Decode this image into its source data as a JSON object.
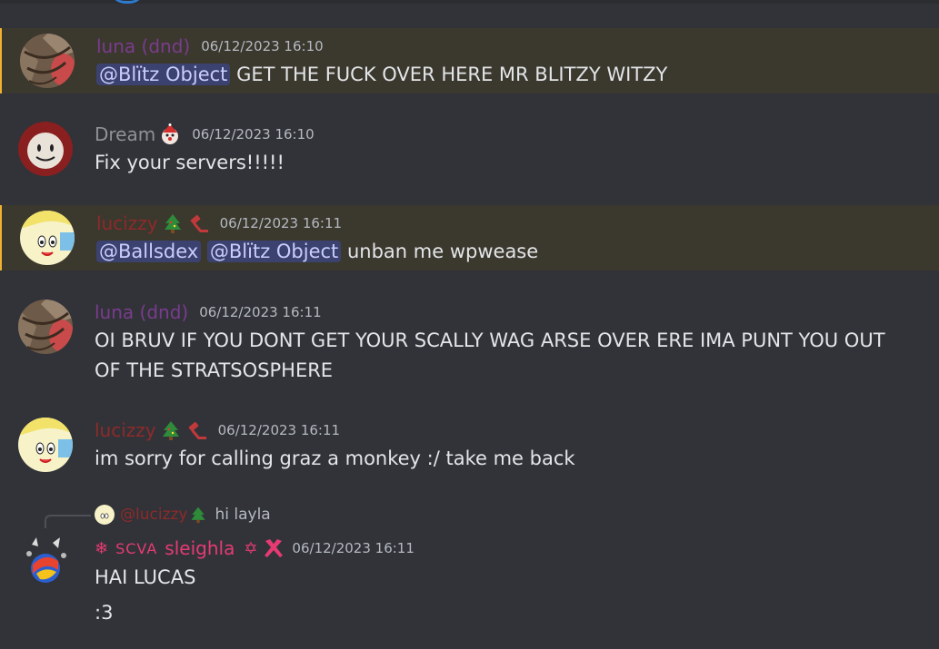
{
  "colors": {
    "background": "#313338",
    "mention_highlight": "#3b382e",
    "mention_pill": "#3c4270",
    "luna": "#7a3c8e",
    "dream": "#8e9297",
    "lucizzy": "#8e2a2a",
    "sleighla": "#e63a73"
  },
  "messages": [
    {
      "username": "luna (dnd)",
      "timestamp": "06/12/2023 16:10",
      "mentions": [
        "@Blïtz Object"
      ],
      "text": "GET THE FUCK OVER HERE MR BLITZY WITZY"
    },
    {
      "username": "Dream",
      "timestamp": "06/12/2023 16:10",
      "text": "Fix your servers!!!!!"
    },
    {
      "username": "lucizzy",
      "timestamp": "06/12/2023 16:11",
      "mentions": [
        "@Ballsdex",
        "@Blïtz Object"
      ],
      "text": "unban me wpwease"
    },
    {
      "username": "luna (dnd)",
      "timestamp": "06/12/2023 16:11",
      "text": "OI BRUV IF YOU DONT GET YOUR SCALLY WAG ARSE OVER ERE IMA PUNT YOU OUT OF THE STRATSOSPHERE"
    },
    {
      "username": "lucizzy",
      "timestamp": "06/12/2023 16:11",
      "text": "im sorry for calling graz a monkey :/ take me back"
    },
    {
      "reply": {
        "username": "@lucizzy",
        "text": "hi layla"
      },
      "tag": "SCVA",
      "username": "sleighla",
      "timestamp": "06/12/2023 16:11",
      "lines": [
        "HAI LUCAS",
        ":3"
      ]
    }
  ]
}
